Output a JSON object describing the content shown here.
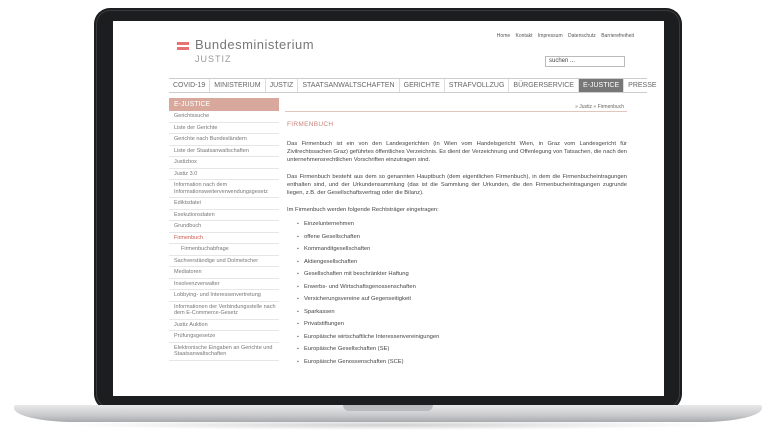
{
  "header": {
    "title": "Bundesministerium",
    "subtitle": "JUSTIZ",
    "top_links": [
      "Home",
      "Kontakt",
      "Impressum",
      "Datenschutz",
      "Barrierefreiheit"
    ],
    "search_value": "suchen ..."
  },
  "nav": {
    "items": [
      "COVID-19",
      "MINISTERIUM",
      "JUSTIZ",
      "STAATSANWALTSCHAFTEN",
      "GERICHTE",
      "STRAFVOLLZUG",
      "BÜRGERSERVICE",
      "E-JUSTICE",
      "PRESSE"
    ],
    "active": "E-JUSTICE"
  },
  "sidebar": {
    "heading": "E-JUSTICE",
    "items": [
      "Gerichtssuche",
      "Liste der Gerichte",
      "Gerichte nach Bundesländern",
      "Liste der Staatsanwaltschaften",
      "Justizbox",
      "Justiz 3.0",
      "Information nach dem Informationsweiterverwendungsgesetz",
      "Ediktsdatei",
      "Exekutionsdaten",
      "Grundbuch",
      "Firmenbuch",
      "Firmenbuchabfrage",
      "Sachverständige und Dolmetscher",
      "Mediatoren",
      "Insolvenzverwalter",
      "Lobbying- und Interessenvertretung",
      "Informationen der Verbindungsstelle nach dem E-Commerce-Gesetz",
      "Justiz Auktion",
      "Prüfungsgesetze",
      "Elektronische Eingaben an Gerichte und Staatsanwaltschaften"
    ]
  },
  "breadcrumb": "» Justiz » Firmenbuch",
  "main": {
    "title": "FIRMENBUCH",
    "paragraph1": "Das Firmenbuch ist ein von den Landesgerichten (in Wien vom Handelsgericht Wien, in Graz vom Landesgericht für Zivilrechtssachen Graz) geführtes öffentliches Verzeichnis. Es dient der Verzeichnung und Offenlegung von Tatsachen, die nach den unternehmensrechtlichen Vorschriften einzutragen sind.",
    "paragraph2": "Das Firmenbuch besteht aus dem so genannten Hauptbuch (dem eigentlichen Firmenbuch), in dem die Firmenbucheintragungen enthalten sind, und der Urkundensammlung (das ist die Sammlung der Urkunden, die den Firmenbucheintragungen zugrunde liegen, z.B. der Gesellschaftsvertrag oder die Bilanz).",
    "intro": "Im Firmenbuch werden folgende Rechtsträger eingetragen:",
    "bullets": [
      "Einzelunternehmen",
      "offene Gesellschaften",
      "Kommanditgesellschaften",
      "Aktiengesellschaften",
      "Gesellschaften mit beschränkter Haftung",
      "Erwerbs- und Wirtschaftsgenossenschaften",
      "Versicherungsvereine auf Gegenseitigkeit",
      "Sparkassen",
      "Privatstiftungen",
      "Europäische wirtschaftliche Interessenvereinigungen",
      "Europäische Gesellschaften (SE)",
      "Europäische Genossenschaften (SCE)"
    ]
  },
  "colors": {
    "accent": "#d7a89b",
    "title": "#c8837a",
    "frame": "#1c1d1f"
  }
}
